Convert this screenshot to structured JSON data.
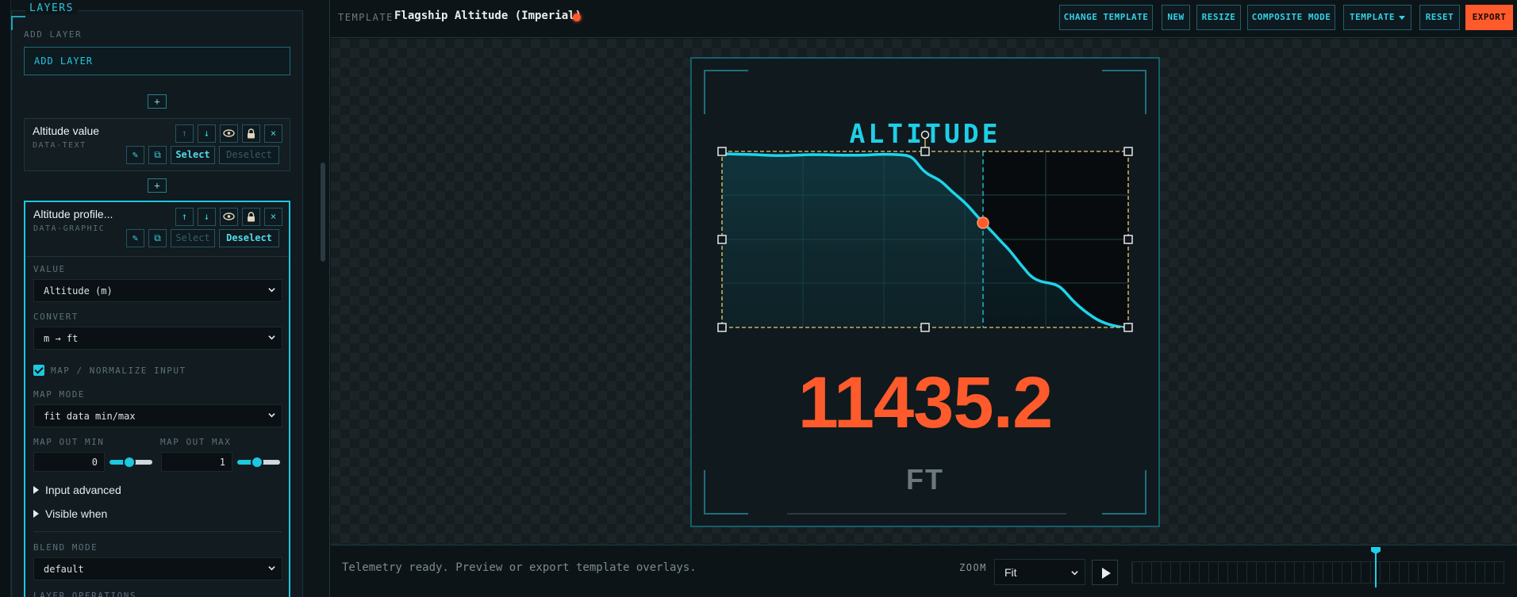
{
  "sidebar": {
    "panel_title": "LAYERS",
    "add_layer_label": "ADD LAYER",
    "add_layer_button": "ADD LAYER",
    "insert_label": "+",
    "layers": [
      {
        "title": "Altitude value",
        "type": "DATA-TEXT",
        "select_label": "Select",
        "deselect_label": "Deselect",
        "selected": false
      },
      {
        "title": "Altitude profile...",
        "type": "DATA-GRAPHIC",
        "select_label": "Select",
        "deselect_label": "Deselect",
        "selected": true
      }
    ],
    "icons": {
      "up": "↑",
      "down": "↓",
      "visible": "👁",
      "lock": "🔒",
      "remove": "×",
      "edit": "✎",
      "duplicate": "⧉"
    },
    "properties": {
      "value_label": "VALUE",
      "value_selected": "Altitude (m)",
      "convert_label": "CONVERT",
      "convert_selected": "m → ft",
      "map_checkbox_label": "MAP / NORMALIZE INPUT",
      "map_checked": true,
      "map_mode_label": "MAP MODE",
      "map_mode_selected": "fit data min/max",
      "map_out_min_label": "MAP OUT MIN",
      "map_out_min_value": "0",
      "map_out_max_label": "MAP OUT MAX",
      "map_out_max_value": "1",
      "input_advanced_label": "Input advanced",
      "visible_when_label": "Visible when",
      "blend_mode_label": "BLEND MODE",
      "blend_mode_selected": "default",
      "layer_operations_label": "LAYER OPERATIONS"
    }
  },
  "topbar": {
    "template_label": "TEMPLATE",
    "template_name": "Flagship Altitude (Imperial)",
    "buttons": {
      "change_template": "CHANGE TEMPLATE",
      "new": "NEW",
      "resize": "RESIZE",
      "composite_mode": "COMPOSITE MODE",
      "template": "TEMPLATE",
      "reset": "RESET",
      "export": "EXPORT"
    }
  },
  "overlay": {
    "title": "ALTITUDE",
    "value": "11435.2",
    "unit": "FT"
  },
  "bottombar": {
    "status": "Telemetry ready. Preview or export template overlays.",
    "zoom_label": "ZOOM",
    "zoom_selected": "Fit"
  },
  "colors": {
    "accent": "#1ecfe6",
    "highlight": "#ff5a2b",
    "background": "#0b1115"
  }
}
